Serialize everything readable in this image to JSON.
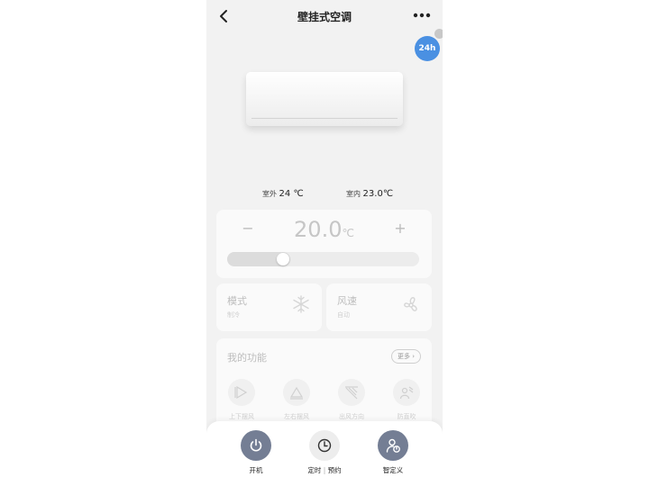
{
  "header": {
    "title": "壁挂式空调"
  },
  "badge": {
    "label": "24h"
  },
  "temps": {
    "outdoor_label": "室外",
    "outdoor_value": "24 ℃",
    "indoor_label": "室内",
    "indoor_value": "23.0℃"
  },
  "control": {
    "setpoint": "20.0",
    "unit": "℃",
    "minus": "−",
    "plus": "+",
    "slider_fraction": 0.33
  },
  "mode": {
    "label": "模式",
    "value": "制冷",
    "icon": "snowflake-icon"
  },
  "fan": {
    "label": "风速",
    "value": "自动",
    "icon": "fan-icon"
  },
  "functions": {
    "title": "我的功能",
    "more_label": "更多",
    "items": [
      {
        "label": "上下摆风",
        "icon": "vertical-swing-icon"
      },
      {
        "label": "左右摆风",
        "icon": "horizontal-swing-icon"
      },
      {
        "label": "出风方向",
        "icon": "airflow-direction-icon"
      },
      {
        "label": "防直吹",
        "icon": "anti-direct-blow-icon"
      }
    ]
  },
  "bottom": {
    "power_label": "开机",
    "timer_label_a": "定时",
    "timer_label_b": "预约",
    "custom_label": "智定义"
  },
  "colors": {
    "accent_blue": "#4a90e2",
    "bottom_icon_bg": "#747e94",
    "timer_icon_bg": "#ededed"
  }
}
